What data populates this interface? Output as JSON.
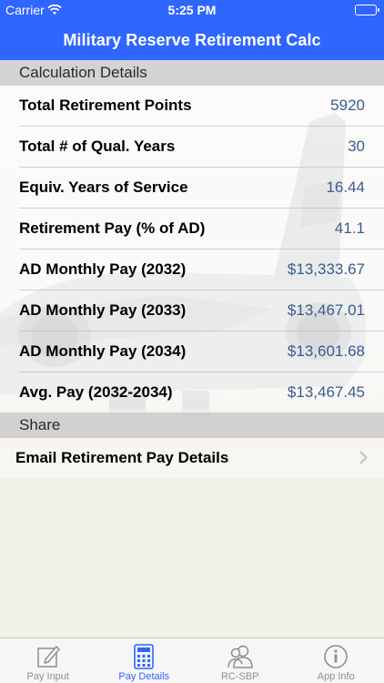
{
  "status_bar": {
    "carrier": "Carrier",
    "time": "5:25 PM"
  },
  "nav": {
    "title": "Military Reserve Retirement Calc"
  },
  "sections": {
    "calc": "Calculation Details",
    "share": "Share"
  },
  "rows": [
    {
      "label": "Total Retirement Points",
      "value": "5920"
    },
    {
      "label": "Total # of Qual. Years",
      "value": "30"
    },
    {
      "label": "Equiv. Years of Service",
      "value": "16.44"
    },
    {
      "label": "Retirement Pay (% of AD)",
      "value": "41.1"
    },
    {
      "label": "AD Monthly Pay (2032)",
      "value": "$13,333.67"
    },
    {
      "label": "AD Monthly Pay (2033)",
      "value": "$13,467.01"
    },
    {
      "label": "AD Monthly Pay (2034)",
      "value": "$13,601.68"
    },
    {
      "label": "Avg. Pay (2032-2034)",
      "value": "$13,467.45"
    }
  ],
  "share_row": {
    "label": "Email Retirement Pay Details"
  },
  "tabs": [
    {
      "label": "Pay Input",
      "icon": "edit-icon",
      "active": false
    },
    {
      "label": "Pay Details",
      "icon": "calculator-icon",
      "active": true
    },
    {
      "label": "RC-SBP",
      "icon": "people-icon",
      "active": false
    },
    {
      "label": "App Info",
      "icon": "info-icon",
      "active": false
    }
  ],
  "colors": {
    "brand": "#2f66ff",
    "value_text": "#3b5a90",
    "tab_inactive": "#8e8e93"
  }
}
